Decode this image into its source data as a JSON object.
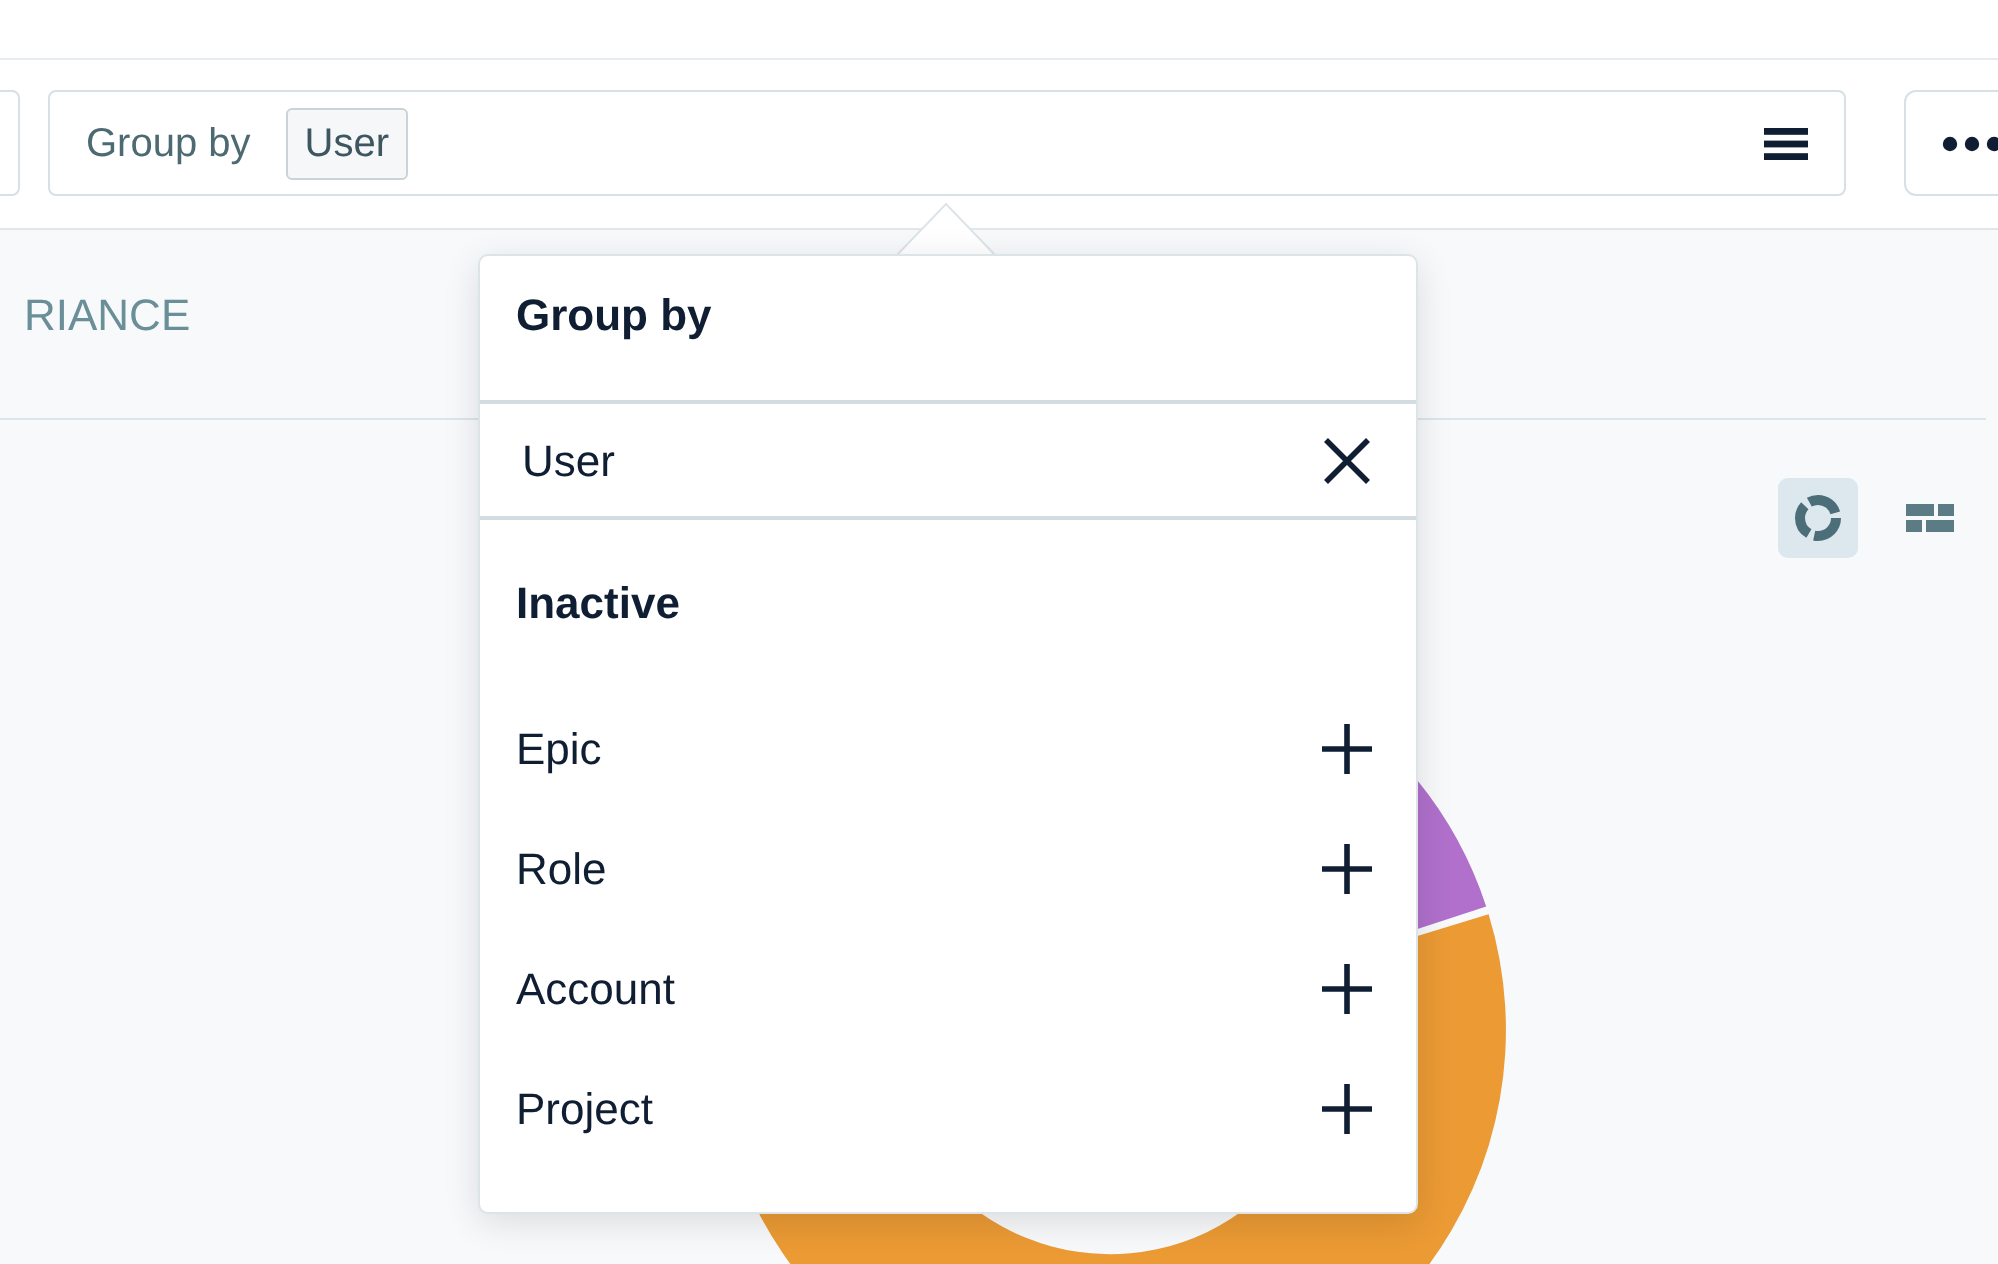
{
  "toolbar": {
    "group_by": {
      "label": "Group by",
      "chips": [
        {
          "label": "User"
        }
      ]
    }
  },
  "stats": [
    {
      "label": "RIANCE"
    }
  ],
  "chart_view": {
    "options": [
      {
        "kind": "donut",
        "selected": true
      },
      {
        "kind": "table",
        "selected": false
      }
    ]
  },
  "popover": {
    "title": "Group by",
    "active": [
      {
        "label": "User"
      }
    ],
    "inactive_heading": "Inactive",
    "inactive": [
      {
        "label": "Epic"
      },
      {
        "label": "Role"
      },
      {
        "label": "Account"
      },
      {
        "label": "Project"
      }
    ]
  }
}
